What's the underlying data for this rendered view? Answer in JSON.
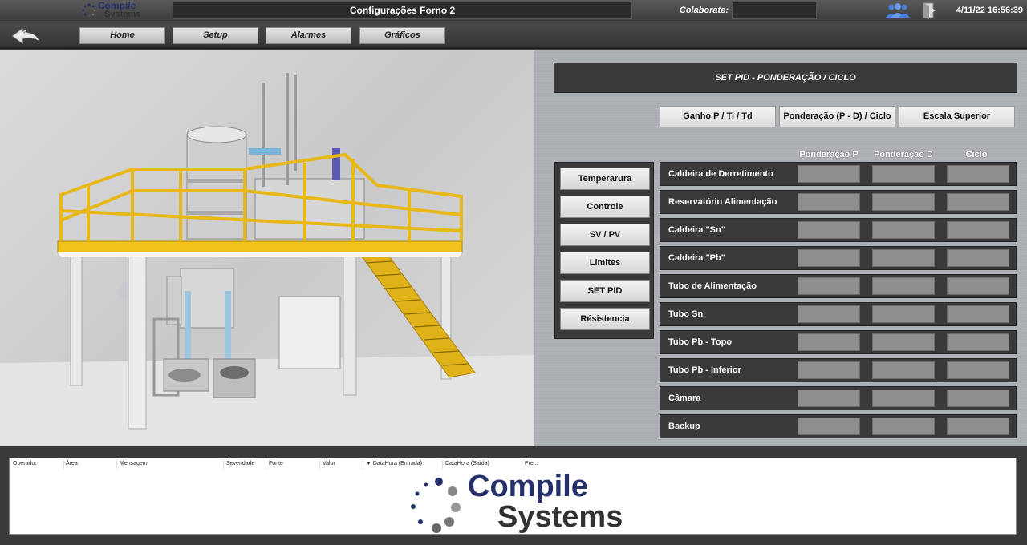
{
  "brand": {
    "line1": "Compile",
    "line2": "Systems"
  },
  "header": {
    "window_title": "Configurações Forno 2",
    "collaborator_label": "Colaborate:",
    "collaborator_value": "",
    "datetime": "4/11/22 16:56:39"
  },
  "nav": {
    "home": "Home",
    "setup": "Setup",
    "alarms": "Alarmes",
    "charts": "Gráficos"
  },
  "panel": {
    "title": "SET PID - PONDERAÇÃO / CICLO",
    "tabs": [
      "Ganho P / Ti  /  Td",
      "Ponderação (P - D)  / Ciclo",
      "Escala Superior"
    ],
    "column_headers": [
      "Ponderação P",
      "Ponderação D",
      "Ciclo"
    ],
    "menu": [
      "Temperarura",
      "Controle",
      "SV  /  PV",
      "Limites",
      "SET PID",
      "Résistencia"
    ],
    "rows": [
      {
        "label": "Caldeira de Derretimento",
        "values": [
          "",
          "",
          ""
        ]
      },
      {
        "label": "Reservatório Alimentação",
        "values": [
          "",
          "",
          ""
        ]
      },
      {
        "label": "Caldeira \"Sn\"",
        "values": [
          "",
          "",
          ""
        ]
      },
      {
        "label": "Caldeira \"Pb\"",
        "values": [
          "",
          "",
          ""
        ]
      },
      {
        "label": "Tubo de Alimentação",
        "values": [
          "",
          "",
          ""
        ]
      },
      {
        "label": "Tubo Sn",
        "values": [
          "",
          "",
          ""
        ]
      },
      {
        "label": "Tubo Pb - Topo",
        "values": [
          "",
          "",
          ""
        ]
      },
      {
        "label": "Tubo Pb - Inferior",
        "values": [
          "",
          "",
          ""
        ]
      },
      {
        "label": "Câmara",
        "values": [
          "",
          "",
          ""
        ]
      },
      {
        "label": "Backup",
        "values": [
          "",
          "",
          ""
        ]
      }
    ]
  },
  "alarms": {
    "columns": [
      "Operador",
      "Área",
      "Mensagem",
      "Severidade",
      "Fonte",
      "Valor",
      "▼ DataHora (Entrada)",
      "DataHora (Saída)",
      "Pre..."
    ]
  },
  "colors": {
    "accent_yellow": "#f2c21b",
    "dark_panel": "#3a3a3a",
    "brand_blue": "#26306b"
  }
}
